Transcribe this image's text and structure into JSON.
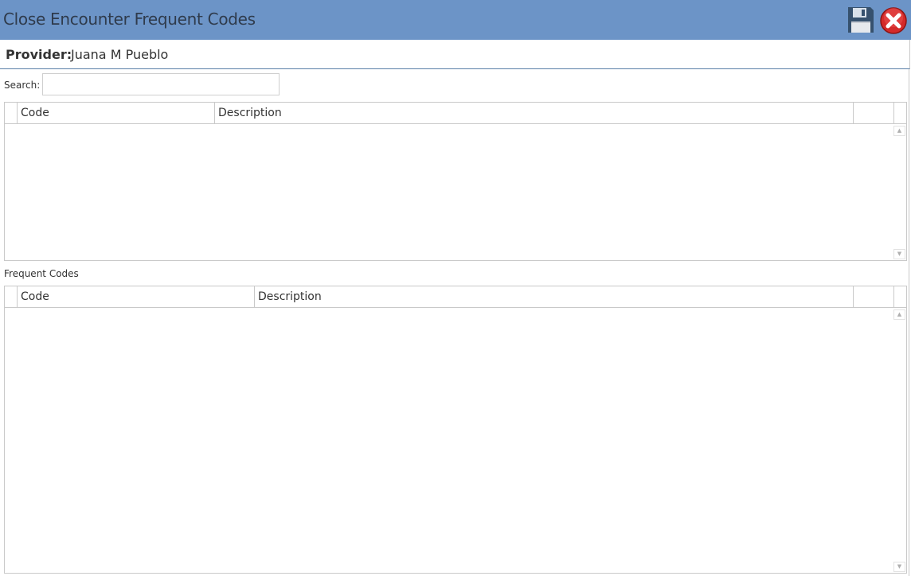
{
  "window": {
    "title": "Close Encounter Frequent Codes",
    "header_color": "#6c94c7"
  },
  "toolbar": {
    "save_icon": "floppy-disk-icon",
    "close_icon": "red-x-close-icon"
  },
  "provider": {
    "label": "Provider:",
    "name": "Juana M Pueblo"
  },
  "search": {
    "label": "Search:",
    "value": "",
    "placeholder": ""
  },
  "search_results": {
    "columns": [
      "Code",
      "Description"
    ],
    "rows": []
  },
  "frequent_codes": {
    "label": "Frequent Codes",
    "columns": [
      "Code",
      "Description"
    ],
    "rows": []
  }
}
